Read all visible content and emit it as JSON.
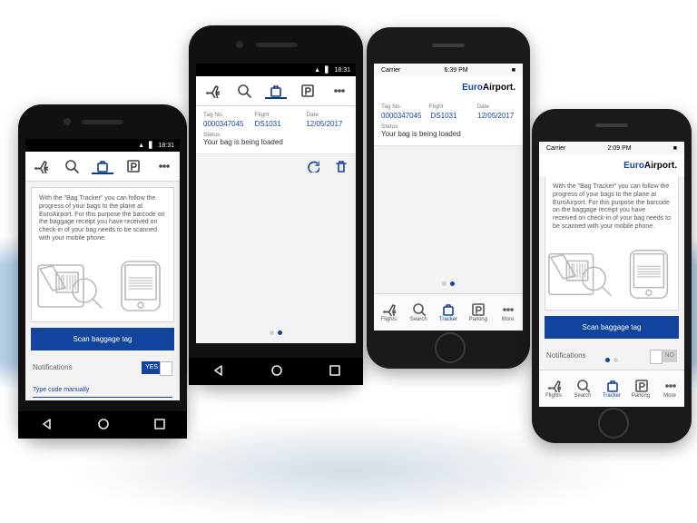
{
  "android": {
    "status_time": "18:31"
  },
  "ios": {
    "status_carrier": "Carrier",
    "status_time_s3": "6:39 PM",
    "status_time_s4": "2:09 PM"
  },
  "brand": {
    "euro": "Euro",
    "airport": "Airport."
  },
  "tabs": {
    "flights": "Flights",
    "search": "Search",
    "tracker": "Tracker",
    "parking": "Parking",
    "more": "More"
  },
  "intro": "With the \"Bag Tracker\" you can follow the progress of your bags to the plane at EuroAirport. For this purpose the barcode on the baggage receipt you have received on check-in of your bag needs to be scanned with your mobile phone.",
  "cta": "Scan baggage tag",
  "notifications": {
    "label": "Notifications",
    "yes": "YES",
    "no": "NO"
  },
  "manual_placeholder": "Type code manually",
  "details": {
    "labels": {
      "tag": "Tag No.",
      "flight": "Flight",
      "date": "Date",
      "status": "Status"
    },
    "tag": "0000347045",
    "flight": "DS1031",
    "date": "12/05/2017",
    "status": "Your bag is being loaded"
  }
}
